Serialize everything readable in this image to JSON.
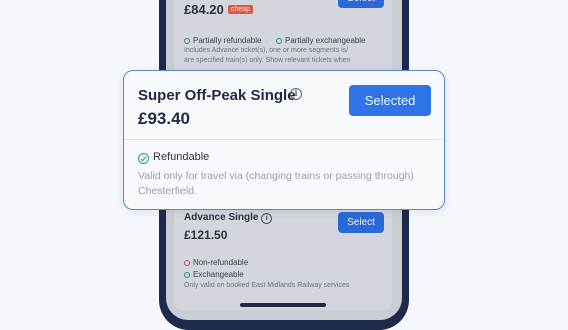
{
  "background_card_top": {
    "price": "£84.20",
    "badge": "cheap",
    "button_label": "Select",
    "features": [
      "Partially refundable",
      "Partially exchangeable"
    ],
    "note_lines": [
      "Includes Advance ticket(s), one or more segments is/",
      "are specified train(s) only. Show relevant tickets when"
    ]
  },
  "popup": {
    "title": "Super Off-Peak Single",
    "info_glyph": "i",
    "price": "£93.40",
    "button_label": "Selected",
    "refund_label": "Refundable",
    "note": "Valid only for travel via (changing trains or passing through) Chesterfield."
  },
  "background_card_bottom": {
    "title": "Advance Single",
    "info_glyph": "i",
    "price": "£121.50",
    "button_label": "Select",
    "refund_label": "Non-refundable",
    "exchange_label": "Exchangeable",
    "note": "Only valid on booked East Midlands Railway services"
  },
  "colors": {
    "accent": "#2f74e6",
    "success": "#2a9a7e",
    "danger": "#c4534b",
    "badge": "#d85a4a"
  }
}
